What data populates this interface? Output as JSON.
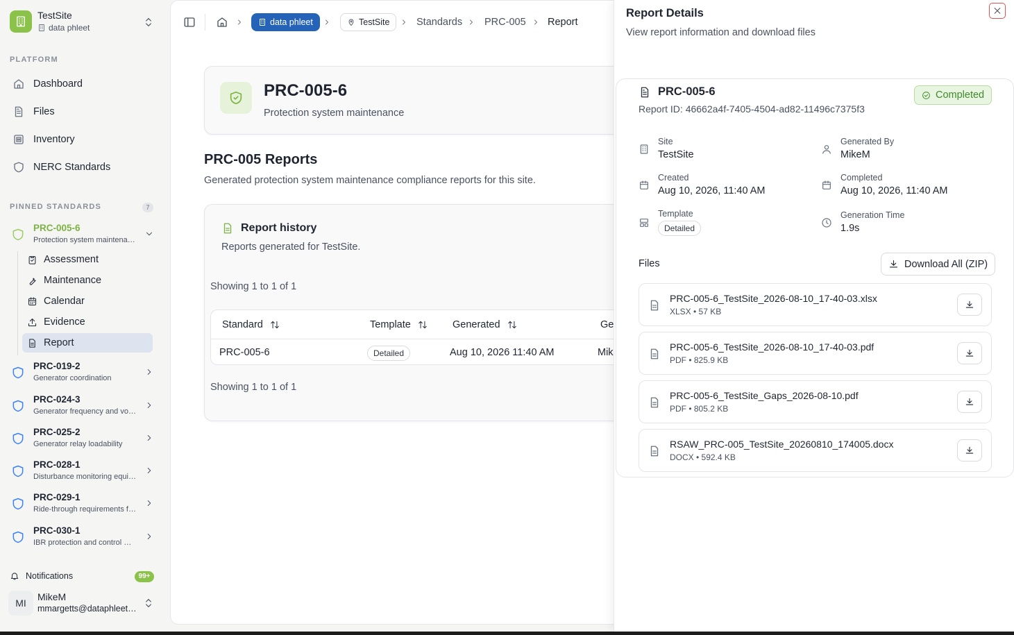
{
  "app": {
    "site_name": "TestSite",
    "org_name": "data phleet"
  },
  "sidebar": {
    "platform_label": "PLATFORM",
    "nav": [
      {
        "label": "Dashboard",
        "icon": "home-icon"
      },
      {
        "label": "Files",
        "icon": "file-icon"
      },
      {
        "label": "Inventory",
        "icon": "inventory-icon"
      },
      {
        "label": "NERC Standards",
        "icon": "shield-icon"
      }
    ],
    "pinned_label": "PINNED STANDARDS",
    "pinned_count": "7",
    "active_standard": {
      "code": "PRC-005-6",
      "desc": "Protection system maintena…"
    },
    "sub_items": [
      {
        "label": "Assessment",
        "icon": "clipboard-check-icon"
      },
      {
        "label": "Maintenance",
        "icon": "wrench-icon"
      },
      {
        "label": "Calendar",
        "icon": "calendar-icon"
      },
      {
        "label": "Evidence",
        "icon": "upload-icon"
      },
      {
        "label": "Report",
        "icon": "report-icon"
      }
    ],
    "standards": [
      {
        "code": "PRC-019-2",
        "desc": "Generator coordination"
      },
      {
        "code": "PRC-024-3",
        "desc": "Generator frequency and vo…"
      },
      {
        "code": "PRC-025-2",
        "desc": "Generator relay loadability"
      },
      {
        "code": "PRC-028-1",
        "desc": "Disturbance monitoring equi…"
      },
      {
        "code": "PRC-029-1",
        "desc": "Ride-through requirements f…"
      },
      {
        "code": "PRC-030-1",
        "desc": "IBR protection and control …"
      }
    ],
    "notifications_label": "Notifications",
    "notifications_count": "99+",
    "user": {
      "initials": "MI",
      "name": "MikeM",
      "email": "mmargetts@dataphleet.…"
    }
  },
  "breadcrumb": {
    "org_chip": "data phleet",
    "site_chip": "TestSite",
    "items": [
      "Standards",
      "PRC-005",
      "Report"
    ]
  },
  "main": {
    "standard_title": "PRC-005-6",
    "standard_subtitle": "Protection system maintenance",
    "reports_title": "PRC-005 Reports",
    "reports_subtitle": "Generated protection system maintenance compliance reports for this site.",
    "history_title": "Report history",
    "history_subtitle": "Reports generated for TestSite.",
    "showing_top": "Showing 1 to 1 of 1",
    "showing_bottom": "Showing 1 to 1 of 1",
    "table": {
      "headers": [
        "Standard",
        "Template",
        "Generated",
        "Ge"
      ],
      "rows": [
        {
          "standard": "PRC-005-6",
          "template": "Detailed",
          "generated": "Aug 10, 2026 11:40 AM",
          "generated_by": "Mik"
        }
      ]
    }
  },
  "drawer": {
    "title": "Report Details",
    "subtitle": "View report information and download files",
    "report_title": "PRC-005-6",
    "report_id": "Report ID: 46662a4f-7405-4504-ad82-11496c7375f3",
    "status": "Completed",
    "fields": {
      "site_label": "Site",
      "site_value": "TestSite",
      "generated_by_label": "Generated By",
      "generated_by_value": "MikeM",
      "created_label": "Created",
      "created_value": "Aug 10, 2026, 11:40 AM",
      "completed_label": "Completed",
      "completed_value": "Aug 10, 2026, 11:40 AM",
      "template_label": "Template",
      "template_value": "Detailed",
      "gen_time_label": "Generation Time",
      "gen_time_value": "1.9s"
    },
    "files_label": "Files",
    "download_all_label": "Download All (ZIP)",
    "files": [
      {
        "name": "PRC-005-6_TestSite_2026-08-10_17-40-03.xlsx",
        "meta": "XLSX • 57 KB"
      },
      {
        "name": "PRC-005-6_TestSite_2026-08-10_17-40-03.pdf",
        "meta": "PDF • 825.9 KB"
      },
      {
        "name": "PRC-005-6_TestSite_Gaps_2026-08-10.pdf",
        "meta": "PDF • 805.2 KB"
      },
      {
        "name": "RSAW_PRC-005_TestSite_20260810_174005.docx",
        "meta": "DOCX • 592.4 KB"
      }
    ]
  },
  "colors": {
    "brand_green": "#8bc34a",
    "chip_blue": "#2563b8",
    "status_green": "#3f8a2a",
    "close_red": "#e05252"
  }
}
